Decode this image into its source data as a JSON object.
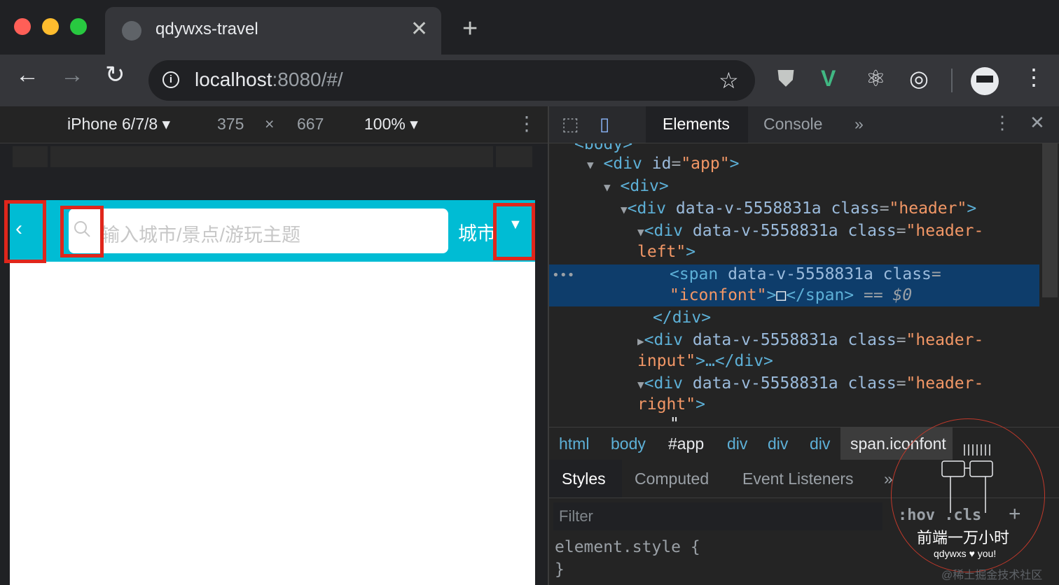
{
  "browser": {
    "tab_title": "qdywxs-travel",
    "url_host": "localhost",
    "url_rest": ":8080/#/"
  },
  "device_toolbar": {
    "device": "iPhone 6/7/8",
    "width": "375",
    "times": "×",
    "height": "667",
    "zoom": "100%"
  },
  "page": {
    "search_placeholder": "输入城市/景点/游玩主题",
    "city_label": "城市",
    "header_color": "#00bcd4"
  },
  "devtools": {
    "tabs": [
      "Elements",
      "Console"
    ],
    "dom_lines": {
      "l0": "<body>",
      "l1_open": "<div ",
      "l1_attr": "id",
      "l1_val": "\"app\"",
      "l2": "<div>",
      "l3_attr": "data-v-5558831a class",
      "l3_val": "\"header\"",
      "l4_attr": "data-v-5558831a class",
      "l4_val1": "\"header-",
      "l4_val2": "left\"",
      "l5_open": "<span ",
      "l5_attr": "data-v-5558831a class",
      "l5_val": "\"iconfont\"",
      "l5_glyph": "□",
      "l5_close": "</span>",
      "l5_eq": "== $0",
      "l6": "</div>",
      "l7_attr": "data-v-5558831a class",
      "l7_val1": "\"header-",
      "l7_val2": "input\"",
      "l7_ellipsis": "…</div>",
      "l8_attr": "data-v-5558831a class",
      "l8_val1": "\"header-",
      "l8_val2": "right\"",
      "l9": "\""
    },
    "breadcrumbs": [
      "html",
      "body",
      "#app",
      "div",
      "div",
      "div",
      "span.iconfont"
    ],
    "style_tabs": [
      "Styles",
      "Computed",
      "Event Listeners"
    ],
    "filter_placeholder": "Filter",
    "hov": ":hov",
    "cls": ".cls",
    "element_style": "element.style {",
    "element_style_close": "}"
  },
  "watermark": {
    "title": "前端一万小时",
    "subtitle": "qdywxs ♥ you!",
    "juejin": "@稀土掘金技术社区"
  }
}
